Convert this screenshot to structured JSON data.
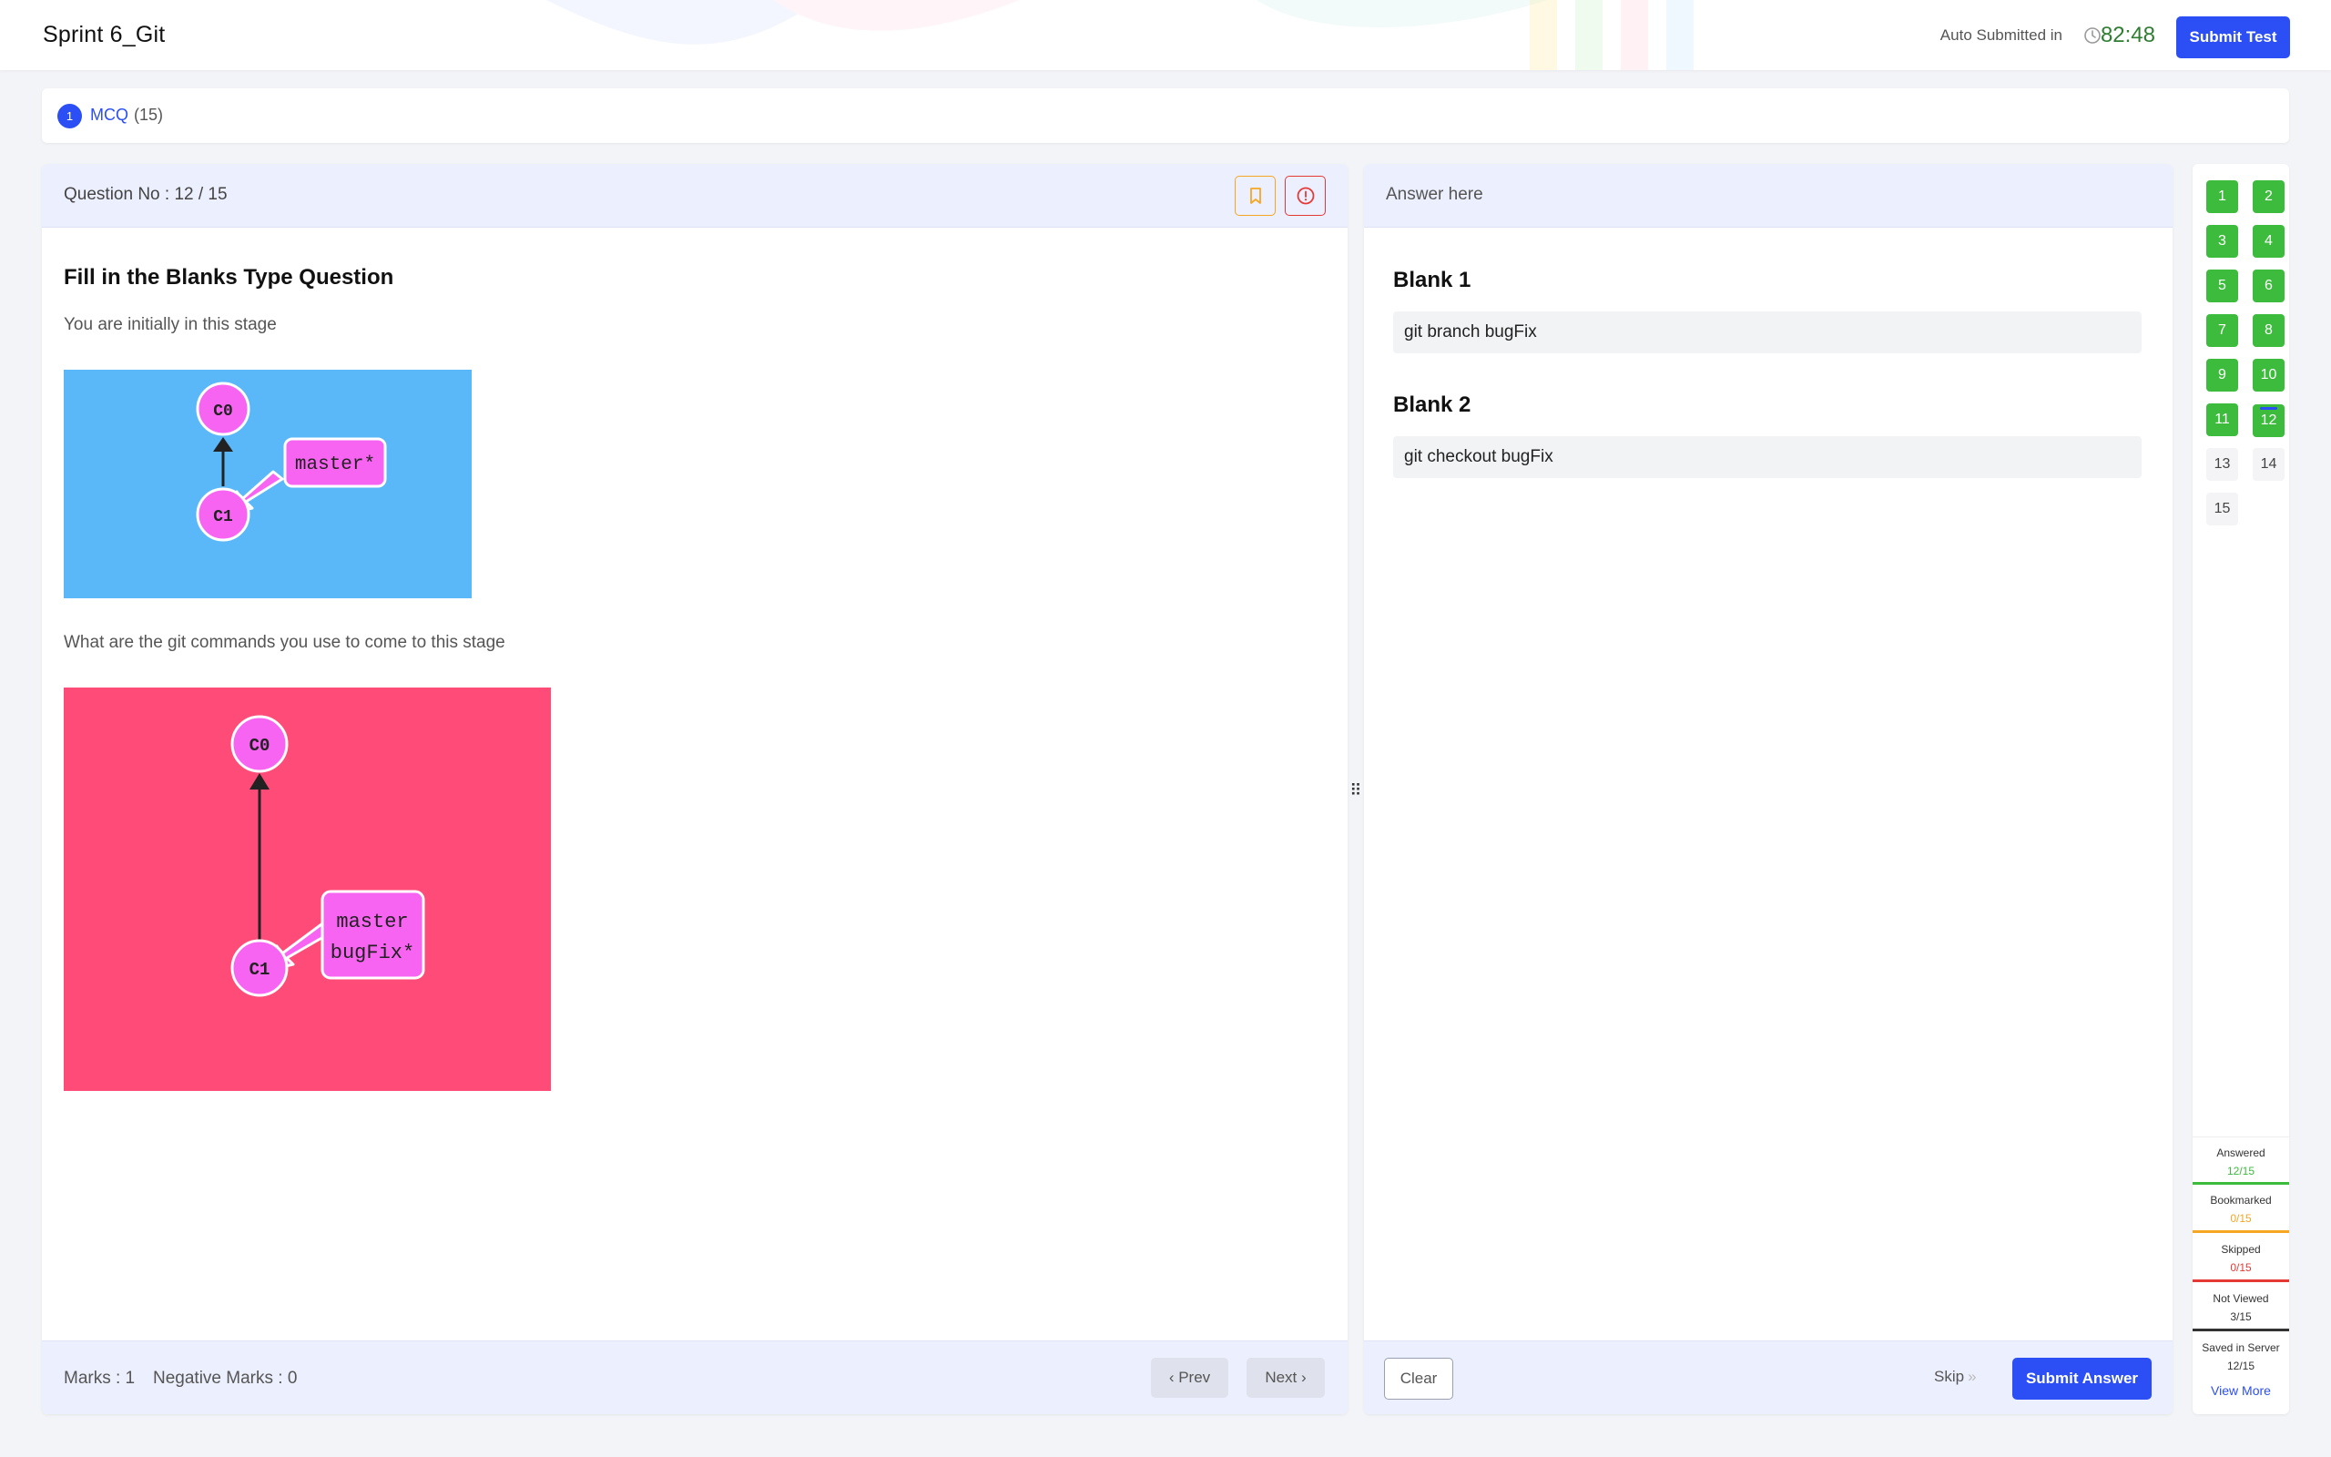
{
  "header": {
    "title": "Sprint 6_Git",
    "auto_submitted_label": "Auto Submitted in",
    "timer": "82:48",
    "submit_test_label": "Submit Test"
  },
  "section": {
    "number": "1",
    "name": "MCQ",
    "count": "(15)"
  },
  "question": {
    "number_label": "Question No : 12 / 15",
    "title": "Fill in the Blanks Type Question",
    "text1": "You are initially in this stage",
    "text2": "What are the git commands you use to come to this stage",
    "image1": {
      "background": "#5bb8f8",
      "nodes": [
        "C0",
        "C1"
      ],
      "branch_label": "master*"
    },
    "image2": {
      "background": "#ff4b78",
      "nodes": [
        "C0",
        "C1"
      ],
      "branch_label_line1": "master",
      "branch_label_line2": "bugFix*"
    },
    "marks": "Marks : 1",
    "negative_marks": "Negative Marks : 0",
    "prev_label": "Prev",
    "next_label": "Next"
  },
  "answer": {
    "title": "Answer here",
    "blanks": [
      {
        "label": "Blank 1",
        "value": "git branch bugFix"
      },
      {
        "label": "Blank 2",
        "value": "git checkout bugFix"
      }
    ],
    "clear_label": "Clear",
    "skip_label": "Skip",
    "submit_label": "Submit Answer"
  },
  "palette": {
    "questions": [
      {
        "n": "1",
        "status": "answered"
      },
      {
        "n": "2",
        "status": "answered"
      },
      {
        "n": "3",
        "status": "answered"
      },
      {
        "n": "4",
        "status": "answered"
      },
      {
        "n": "5",
        "status": "answered"
      },
      {
        "n": "6",
        "status": "answered"
      },
      {
        "n": "7",
        "status": "answered"
      },
      {
        "n": "8",
        "status": "answered"
      },
      {
        "n": "9",
        "status": "answered"
      },
      {
        "n": "10",
        "status": "answered"
      },
      {
        "n": "11",
        "status": "answered"
      },
      {
        "n": "12",
        "status": "answered-current"
      },
      {
        "n": "13",
        "status": "not-viewed"
      },
      {
        "n": "14",
        "status": "not-viewed"
      },
      {
        "n": "15",
        "status": "not-viewed"
      }
    ],
    "stats": [
      {
        "label": "Answered",
        "value": "12/15",
        "color": "#3dbb3d"
      },
      {
        "label": "Bookmarked",
        "value": "0/15",
        "color": "#f5a623"
      },
      {
        "label": "Skipped",
        "value": "0/15",
        "color": "#e53935"
      },
      {
        "label": "Not Viewed",
        "value": "3/15",
        "color": "#333333"
      },
      {
        "label": "Saved in Server",
        "value": "12/15",
        "color": "#333333"
      }
    ],
    "view_more": "View More"
  },
  "colors": {
    "accent": "#2b4ef5",
    "answered": "#3dbb3d",
    "timer": "#2f7d32"
  },
  "icons": [
    "clock-icon",
    "bookmark-icon",
    "alert-circle-icon",
    "chevron-left-icon",
    "chevron-right-icon",
    "double-chevron-right-icon",
    "drag-handle-icon"
  ]
}
